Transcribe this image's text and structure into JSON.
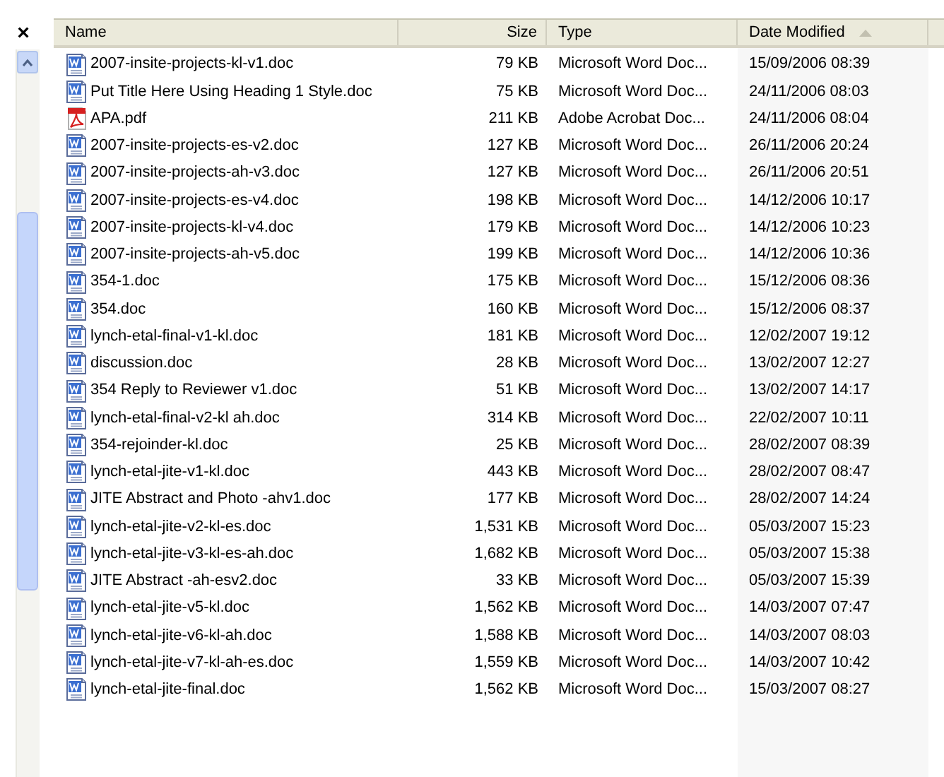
{
  "close_button": "×",
  "columns": [
    {
      "label": "Name",
      "sorted": false
    },
    {
      "label": "Size",
      "sorted": false
    },
    {
      "label": "Type",
      "sorted": false
    },
    {
      "label": "Date Modified",
      "sorted": true
    }
  ],
  "rows": [
    {
      "kind": "word",
      "name": "2007-insite-projects-kl-v1.doc",
      "size": "79 KB",
      "type": "Microsoft Word Doc...",
      "date": "15/09/2006 08:39"
    },
    {
      "kind": "word",
      "name": "Put Title Here Using Heading 1 Style.doc",
      "size": "75 KB",
      "type": "Microsoft Word Doc...",
      "date": "24/11/2006 08:03"
    },
    {
      "kind": "pdf",
      "name": "APA.pdf",
      "size": "211 KB",
      "type": "Adobe Acrobat Doc...",
      "date": "24/11/2006 08:04"
    },
    {
      "kind": "word",
      "name": "2007-insite-projects-es-v2.doc",
      "size": "127 KB",
      "type": "Microsoft Word Doc...",
      "date": "26/11/2006 20:24"
    },
    {
      "kind": "word",
      "name": "2007-insite-projects-ah-v3.doc",
      "size": "127 KB",
      "type": "Microsoft Word Doc...",
      "date": "26/11/2006 20:51"
    },
    {
      "kind": "word",
      "name": "2007-insite-projects-es-v4.doc",
      "size": "198 KB",
      "type": "Microsoft Word Doc...",
      "date": "14/12/2006 10:17"
    },
    {
      "kind": "word",
      "name": "2007-insite-projects-kl-v4.doc",
      "size": "179 KB",
      "type": "Microsoft Word Doc...",
      "date": "14/12/2006 10:23"
    },
    {
      "kind": "word",
      "name": "2007-insite-projects-ah-v5.doc",
      "size": "199 KB",
      "type": "Microsoft Word Doc...",
      "date": "14/12/2006 10:36"
    },
    {
      "kind": "word",
      "name": "354-1.doc",
      "size": "175 KB",
      "type": "Microsoft Word Doc...",
      "date": "15/12/2006 08:36"
    },
    {
      "kind": "word",
      "name": "354.doc",
      "size": "160 KB",
      "type": "Microsoft Word Doc...",
      "date": "15/12/2006 08:37"
    },
    {
      "kind": "word",
      "name": "lynch-etal-final-v1-kl.doc",
      "size": "181 KB",
      "type": "Microsoft Word Doc...",
      "date": "12/02/2007 19:12"
    },
    {
      "kind": "word",
      "name": "discussion.doc",
      "size": "28 KB",
      "type": "Microsoft Word Doc...",
      "date": "13/02/2007 12:27"
    },
    {
      "kind": "word",
      "name": "354 Reply to Reviewer v1.doc",
      "size": "51 KB",
      "type": "Microsoft Word Doc...",
      "date": "13/02/2007 14:17"
    },
    {
      "kind": "word",
      "name": "lynch-etal-final-v2-kl ah.doc",
      "size": "314 KB",
      "type": "Microsoft Word Doc...",
      "date": "22/02/2007 10:11"
    },
    {
      "kind": "word",
      "name": "354-rejoinder-kl.doc",
      "size": "25 KB",
      "type": "Microsoft Word Doc...",
      "date": "28/02/2007 08:39"
    },
    {
      "kind": "word",
      "name": "lynch-etal-jite-v1-kl.doc",
      "size": "443 KB",
      "type": "Microsoft Word Doc...",
      "date": "28/02/2007 08:47"
    },
    {
      "kind": "word",
      "name": "JITE Abstract and Photo -ahv1.doc",
      "size": "177 KB",
      "type": "Microsoft Word Doc...",
      "date": "28/02/2007 14:24"
    },
    {
      "kind": "word",
      "name": "lynch-etal-jite-v2-kl-es.doc",
      "size": "1,531 KB",
      "type": "Microsoft Word Doc...",
      "date": "05/03/2007 15:23"
    },
    {
      "kind": "word",
      "name": "lynch-etal-jite-v3-kl-es-ah.doc",
      "size": "1,682 KB",
      "type": "Microsoft Word Doc...",
      "date": "05/03/2007 15:38"
    },
    {
      "kind": "word",
      "name": "JITE Abstract -ah-esv2.doc",
      "size": "33 KB",
      "type": "Microsoft Word Doc...",
      "date": "05/03/2007 15:39"
    },
    {
      "kind": "word",
      "name": "lynch-etal-jite-v5-kl.doc",
      "size": "1,562 KB",
      "type": "Microsoft Word Doc...",
      "date": "14/03/2007 07:47"
    },
    {
      "kind": "word",
      "name": "lynch-etal-jite-v6-kl-ah.doc",
      "size": "1,588 KB",
      "type": "Microsoft Word Doc...",
      "date": "14/03/2007 08:03"
    },
    {
      "kind": "word",
      "name": "lynch-etal-jite-v7-kl-ah-es.doc",
      "size": "1,559 KB",
      "type": "Microsoft Word Doc...",
      "date": "14/03/2007 10:42"
    },
    {
      "kind": "word",
      "name": "lynch-etal-jite-final.doc",
      "size": "1,562 KB",
      "type": "Microsoft Word Doc...",
      "date": "15/03/2007 08:27"
    }
  ]
}
